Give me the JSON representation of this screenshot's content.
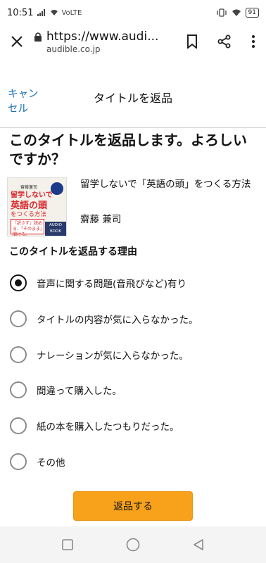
{
  "status_bar": {
    "time": "10:51",
    "network": "VoLTE",
    "battery": "91"
  },
  "browser": {
    "url": "https://www.audi...",
    "domain": "audible.co.jp",
    "icons": [
      "close-icon",
      "lock-icon",
      "bookmark-icon",
      "share-icon",
      "more-vert-icon"
    ]
  },
  "dialog": {
    "cancel_label": "キャンセル",
    "title": "タイトルを返品"
  },
  "question": "このタイトルを返品します。よろしいですか？",
  "book": {
    "title": "留学しないで「英語の頭」をつくる方法",
    "author": "齋藤 兼司",
    "cover": {
      "author": "齋藤兼司",
      "line1": "留学しないで",
      "line2": "英語の頭",
      "line3": "をつくる方法",
      "tagline": "「訳さず」読める、「そのまま」聞ける。",
      "badge": "AUDIO BOOK"
    }
  },
  "reasons": {
    "heading": "このタイトルを返品する理由",
    "selected_index": 0,
    "options": [
      "音声に関する問題(音飛びなど)有り",
      "タイトルの内容が気に入らなかった。",
      "ナレーションが気に入らなかった。",
      "間違って購入した。",
      "紙の本を購入したつもりだった。",
      "その他"
    ]
  },
  "submit_label": "返品する",
  "colors": {
    "link": "#1a6fb3",
    "submit_bg": "#f7a21a",
    "cover_red": "#d9262c"
  }
}
